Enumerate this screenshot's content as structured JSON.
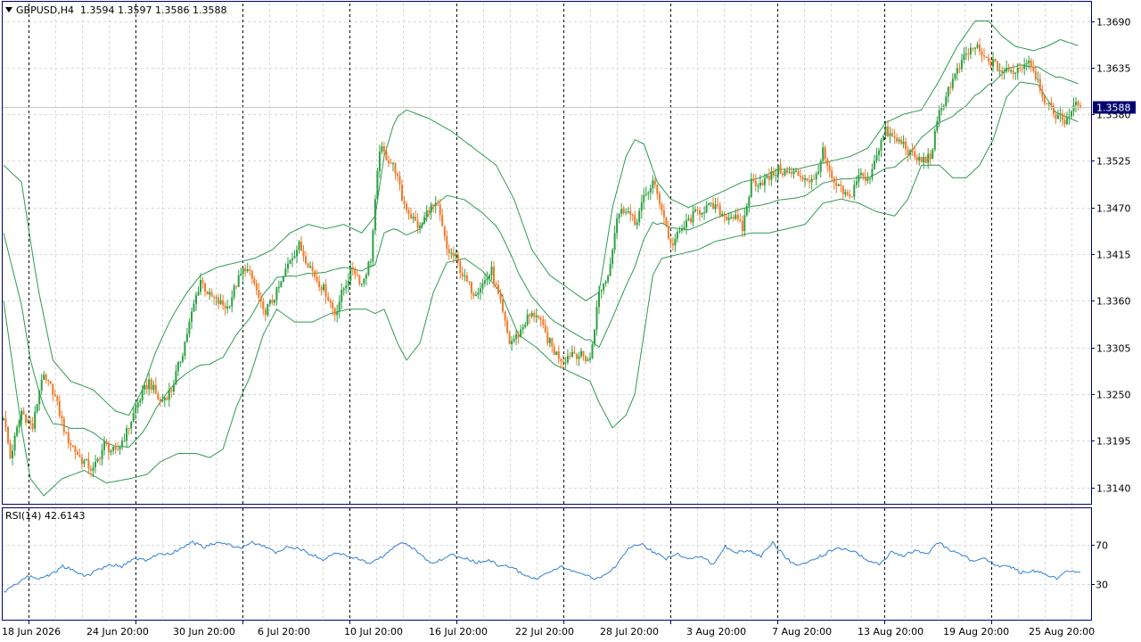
{
  "header": {
    "symbol": "GBPUSD,H4",
    "open": "1.3594",
    "high": "1.3597",
    "low": "1.3586",
    "close": "1.3588"
  },
  "rsi": {
    "label": "RSI(14)",
    "value": "42.6143",
    "levels": [
      "100",
      "70",
      "30",
      "0"
    ]
  },
  "colors": {
    "bull": "#2ea043",
    "bear": "#f07a2a",
    "band": "#2e9a52",
    "rsi_line": "#2f7fd6",
    "grid": "#d8d8d8",
    "separator": "#000000",
    "axis": "#00006e",
    "price_tag_bg": "#00006e",
    "price_tag_text": "#ffffff"
  },
  "chart_data": [
    {
      "type": "candlestick",
      "symbol": "GBPUSD",
      "timeframe": "H4",
      "price_axis_ticks": [
        "1.3690",
        "1.3635",
        "1.3580",
        "1.3525",
        "1.3470",
        "1.3415",
        "1.3360",
        "1.3305",
        "1.3250",
        "1.3195",
        "1.3140"
      ],
      "time_axis_ticks": [
        "18 Jun 2026",
        "24 Jun 20:00",
        "30 Jun 20:00",
        "6 Jul 20:00",
        "10 Jul 20:00",
        "16 Jul 20:00",
        "22 Jul 20:00",
        "28 Jul 20:00",
        "3 Aug 20:00",
        "7 Aug 20:00",
        "13 Aug 20:00",
        "19 Aug 20:00",
        "25 Aug 20:00"
      ],
      "ylim": [
        1.3123,
        1.3708
      ],
      "current_price": "1.3588",
      "indicator": "Bollinger Bands (20, 2)",
      "grid": true,
      "close_path": [
        [
          0,
          1.3225
        ],
        [
          3,
          1.3175
        ],
        [
          8,
          1.323
        ],
        [
          13,
          1.321
        ],
        [
          17,
          1.327
        ],
        [
          22,
          1.3255
        ],
        [
          28,
          1.32
        ],
        [
          34,
          1.3175
        ],
        [
          40,
          1.316
        ],
        [
          45,
          1.319
        ],
        [
          50,
          1.318
        ],
        [
          55,
          1.3205
        ],
        [
          60,
          1.324
        ],
        [
          65,
          1.3265
        ],
        [
          70,
          1.324
        ],
        [
          75,
          1.3255
        ],
        [
          80,
          1.33
        ],
        [
          85,
          1.3355
        ],
        [
          88,
          1.3385
        ],
        [
          92,
          1.3365
        ],
        [
          96,
          1.3358
        ],
        [
          100,
          1.3352
        ],
        [
          104,
          1.338
        ],
        [
          108,
          1.34
        ],
        [
          112,
          1.338
        ],
        [
          116,
          1.3345
        ],
        [
          120,
          1.336
        ],
        [
          124,
          1.338
        ],
        [
          128,
          1.341
        ],
        [
          132,
          1.3425
        ],
        [
          136,
          1.3405
        ],
        [
          140,
          1.3385
        ],
        [
          144,
          1.337
        ],
        [
          148,
          1.3345
        ],
        [
          152,
          1.3375
        ],
        [
          156,
          1.34
        ],
        [
          160,
          1.338
        ],
        [
          164,
          1.341
        ],
        [
          168,
          1.354
        ],
        [
          171,
          1.353
        ],
        [
          175,
          1.3515
        ],
        [
          178,
          1.348
        ],
        [
          182,
          1.346
        ],
        [
          186,
          1.3445
        ],
        [
          190,
          1.347
        ],
        [
          194,
          1.347
        ],
        [
          198,
          1.342
        ],
        [
          202,
          1.341
        ],
        [
          206,
          1.3385
        ],
        [
          210,
          1.337
        ],
        [
          214,
          1.338
        ],
        [
          218,
          1.3395
        ],
        [
          222,
          1.3355
        ],
        [
          226,
          1.331
        ],
        [
          230,
          1.332
        ],
        [
          234,
          1.334
        ],
        [
          238,
          1.3345
        ],
        [
          242,
          1.332
        ],
        [
          246,
          1.33
        ],
        [
          250,
          1.329
        ],
        [
          254,
          1.33
        ],
        [
          258,
          1.3295
        ],
        [
          262,
          1.329
        ],
        [
          266,
          1.337
        ],
        [
          270,
          1.339
        ],
        [
          274,
          1.346
        ],
        [
          278,
          1.347
        ],
        [
          282,
          1.345
        ],
        [
          286,
          1.348
        ],
        [
          290,
          1.35
        ],
        [
          294,
          1.347
        ],
        [
          298,
          1.3425
        ],
        [
          302,
          1.344
        ],
        [
          306,
          1.3455
        ],
        [
          310,
          1.3465
        ],
        [
          314,
          1.347
        ],
        [
          318,
          1.347
        ],
        [
          322,
          1.346
        ],
        [
          326,
          1.346
        ],
        [
          330,
          1.3445
        ],
        [
          334,
          1.35
        ],
        [
          338,
          1.35
        ],
        [
          342,
          1.3505
        ],
        [
          346,
          1.3515
        ],
        [
          350,
          1.351
        ],
        [
          354,
          1.351
        ],
        [
          358,
          1.3505
        ],
        [
          362,
          1.35
        ],
        [
          366,
          1.3535
        ],
        [
          370,
          1.35
        ],
        [
          374,
          1.349
        ],
        [
          378,
          1.348
        ],
        [
          382,
          1.351
        ],
        [
          386,
          1.35
        ],
        [
          390,
          1.3535
        ],
        [
          394,
          1.356
        ],
        [
          398,
          1.355
        ],
        [
          402,
          1.3545
        ],
        [
          406,
          1.353
        ],
        [
          410,
          1.3525
        ],
        [
          414,
          1.353
        ],
        [
          418,
          1.358
        ],
        [
          422,
          1.361
        ],
        [
          426,
          1.363
        ],
        [
          430,
          1.365
        ],
        [
          434,
          1.366
        ],
        [
          438,
          1.3645
        ],
        [
          442,
          1.364
        ],
        [
          446,
          1.363
        ],
        [
          450,
          1.363
        ],
        [
          454,
          1.3635
        ],
        [
          458,
          1.3645
        ],
        [
          462,
          1.362
        ],
        [
          466,
          1.359
        ],
        [
          470,
          1.358
        ],
        [
          474,
          1.3572
        ],
        [
          478,
          1.359
        ],
        [
          481,
          1.3588
        ]
      ],
      "bollinger_upper_path": [
        [
          0,
          1.352
        ],
        [
          8,
          1.35
        ],
        [
          15,
          1.338
        ],
        [
          22,
          1.329
        ],
        [
          30,
          1.3265
        ],
        [
          40,
          1.3255
        ],
        [
          50,
          1.323
        ],
        [
          56,
          1.3225
        ],
        [
          62,
          1.3255
        ],
        [
          68,
          1.33
        ],
        [
          75,
          1.334
        ],
        [
          82,
          1.337
        ],
        [
          88,
          1.339
        ],
        [
          96,
          1.34
        ],
        [
          104,
          1.3405
        ],
        [
          112,
          1.341
        ],
        [
          120,
          1.342
        ],
        [
          128,
          1.344
        ],
        [
          136,
          1.345
        ],
        [
          144,
          1.3445
        ],
        [
          152,
          1.345
        ],
        [
          160,
          1.344
        ],
        [
          166,
          1.346
        ],
        [
          170,
          1.353
        ],
        [
          175,
          1.3575
        ],
        [
          180,
          1.3585
        ],
        [
          190,
          1.3575
        ],
        [
          200,
          1.356
        ],
        [
          210,
          1.354
        ],
        [
          220,
          1.352
        ],
        [
          228,
          1.348
        ],
        [
          236,
          1.342
        ],
        [
          244,
          1.339
        ],
        [
          252,
          1.3375
        ],
        [
          260,
          1.336
        ],
        [
          266,
          1.337
        ],
        [
          272,
          1.347
        ],
        [
          278,
          1.353
        ],
        [
          282,
          1.355
        ],
        [
          286,
          1.3545
        ],
        [
          292,
          1.35
        ],
        [
          298,
          1.348
        ],
        [
          306,
          1.347
        ],
        [
          314,
          1.348
        ],
        [
          322,
          1.349
        ],
        [
          330,
          1.35
        ],
        [
          338,
          1.3505
        ],
        [
          346,
          1.3515
        ],
        [
          354,
          1.3515
        ],
        [
          362,
          1.352
        ],
        [
          370,
          1.3525
        ],
        [
          378,
          1.353
        ],
        [
          386,
          1.354
        ],
        [
          394,
          1.357
        ],
        [
          402,
          1.358
        ],
        [
          410,
          1.3585
        ],
        [
          418,
          1.362
        ],
        [
          426,
          1.366
        ],
        [
          434,
          1.369
        ],
        [
          440,
          1.369
        ],
        [
          446,
          1.3672
        ],
        [
          452,
          1.366
        ],
        [
          460,
          1.3655
        ],
        [
          466,
          1.366
        ],
        [
          472,
          1.3668
        ],
        [
          481,
          1.366
        ]
      ],
      "bollinger_lower_path": [
        [
          0,
          1.336
        ],
        [
          8,
          1.321
        ],
        [
          12,
          1.315
        ],
        [
          18,
          1.313
        ],
        [
          26,
          1.315
        ],
        [
          36,
          1.316
        ],
        [
          46,
          1.3145
        ],
        [
          56,
          1.315
        ],
        [
          64,
          1.3155
        ],
        [
          70,
          1.317
        ],
        [
          78,
          1.318
        ],
        [
          86,
          1.318
        ],
        [
          92,
          1.3175
        ],
        [
          98,
          1.3185
        ],
        [
          104,
          1.3235
        ],
        [
          110,
          1.327
        ],
        [
          116,
          1.332
        ],
        [
          122,
          1.335
        ],
        [
          130,
          1.3335
        ],
        [
          138,
          1.3335
        ],
        [
          146,
          1.3345
        ],
        [
          154,
          1.335
        ],
        [
          162,
          1.335
        ],
        [
          166,
          1.3345
        ],
        [
          170,
          1.335
        ],
        [
          176,
          1.331
        ],
        [
          180,
          1.329
        ],
        [
          186,
          1.331
        ],
        [
          192,
          1.337
        ],
        [
          198,
          1.3405
        ],
        [
          206,
          1.341
        ],
        [
          214,
          1.3395
        ],
        [
          222,
          1.337
        ],
        [
          230,
          1.332
        ],
        [
          238,
          1.3305
        ],
        [
          246,
          1.3285
        ],
        [
          254,
          1.3275
        ],
        [
          262,
          1.3265
        ],
        [
          266,
          1.324
        ],
        [
          272,
          1.321
        ],
        [
          278,
          1.3225
        ],
        [
          282,
          1.325
        ],
        [
          286,
          1.332
        ],
        [
          290,
          1.339
        ],
        [
          294,
          1.341
        ],
        [
          302,
          1.3415
        ],
        [
          310,
          1.342
        ],
        [
          318,
          1.343
        ],
        [
          326,
          1.3435
        ],
        [
          334,
          1.344
        ],
        [
          342,
          1.344
        ],
        [
          350,
          1.3445
        ],
        [
          358,
          1.345
        ],
        [
          366,
          1.3475
        ],
        [
          374,
          1.348
        ],
        [
          382,
          1.3475
        ],
        [
          390,
          1.3465
        ],
        [
          398,
          1.346
        ],
        [
          404,
          1.348
        ],
        [
          410,
          1.352
        ],
        [
          418,
          1.352
        ],
        [
          424,
          1.3505
        ],
        [
          430,
          1.3505
        ],
        [
          436,
          1.352
        ],
        [
          442,
          1.355
        ],
        [
          448,
          1.36
        ],
        [
          454,
          1.3618
        ],
        [
          462,
          1.3615
        ],
        [
          470,
          1.3582
        ],
        [
          481,
          1.357
        ]
      ]
    },
    {
      "type": "line",
      "name": "RSI(14)",
      "ylim": [
        0,
        100
      ],
      "levels": [
        70,
        30
      ],
      "current_value": 42.6143,
      "path": [
        [
          0,
          22
        ],
        [
          6,
          30
        ],
        [
          12,
          38
        ],
        [
          18,
          36
        ],
        [
          24,
          40
        ],
        [
          30,
          48
        ],
        [
          36,
          44
        ],
        [
          42,
          38
        ],
        [
          48,
          45
        ],
        [
          54,
          50
        ],
        [
          60,
          48
        ],
        [
          66,
          56
        ],
        [
          72,
          54
        ],
        [
          78,
          60
        ],
        [
          84,
          60
        ],
        [
          90,
          66
        ],
        [
          96,
          72
        ],
        [
          102,
          67
        ],
        [
          108,
          72
        ],
        [
          114,
          70
        ],
        [
          120,
          66
        ],
        [
          126,
          72
        ],
        [
          132,
          68
        ],
        [
          138,
          62
        ],
        [
          144,
          67
        ],
        [
          150,
          66
        ],
        [
          156,
          60
        ],
        [
          162,
          55
        ],
        [
          168,
          62
        ],
        [
          174,
          58
        ],
        [
          180,
          56
        ],
        [
          186,
          50
        ],
        [
          192,
          58
        ],
        [
          198,
          68
        ],
        [
          204,
          72
        ],
        [
          210,
          62
        ],
        [
          216,
          52
        ],
        [
          222,
          54
        ],
        [
          228,
          60
        ],
        [
          234,
          56
        ],
        [
          240,
          52
        ],
        [
          246,
          54
        ],
        [
          252,
          48
        ],
        [
          258,
          48
        ],
        [
          264,
          38
        ],
        [
          270,
          36
        ],
        [
          276,
          42
        ],
        [
          282,
          48
        ],
        [
          288,
          44
        ],
        [
          294,
          40
        ],
        [
          300,
          35
        ],
        [
          306,
          40
        ],
        [
          312,
          52
        ],
        [
          318,
          68
        ],
        [
          324,
          70
        ],
        [
          330,
          62
        ],
        [
          336,
          56
        ],
        [
          342,
          60
        ],
        [
          348,
          56
        ],
        [
          354,
          58
        ],
        [
          360,
          50
        ],
        [
          366,
          68
        ],
        [
          372,
          62
        ],
        [
          378,
          64
        ],
        [
          384,
          58
        ],
        [
          390,
          72
        ],
        [
          396,
          58
        ],
        [
          402,
          48
        ],
        [
          408,
          52
        ],
        [
          414,
          58
        ],
        [
          420,
          64
        ],
        [
          426,
          66
        ],
        [
          432,
          62
        ],
        [
          438,
          54
        ],
        [
          444,
          50
        ],
        [
          450,
          62
        ],
        [
          456,
          58
        ],
        [
          462,
          64
        ],
        [
          468,
          60
        ],
        [
          474,
          72
        ],
        [
          480,
          64
        ],
        [
          486,
          60
        ],
        [
          492,
          52
        ],
        [
          498,
          56
        ],
        [
          504,
          48
        ],
        [
          510,
          48
        ],
        [
          516,
          42
        ],
        [
          522,
          44
        ],
        [
          528,
          40
        ],
        [
          534,
          36
        ],
        [
          540,
          44
        ],
        [
          546,
          42
        ]
      ]
    }
  ]
}
